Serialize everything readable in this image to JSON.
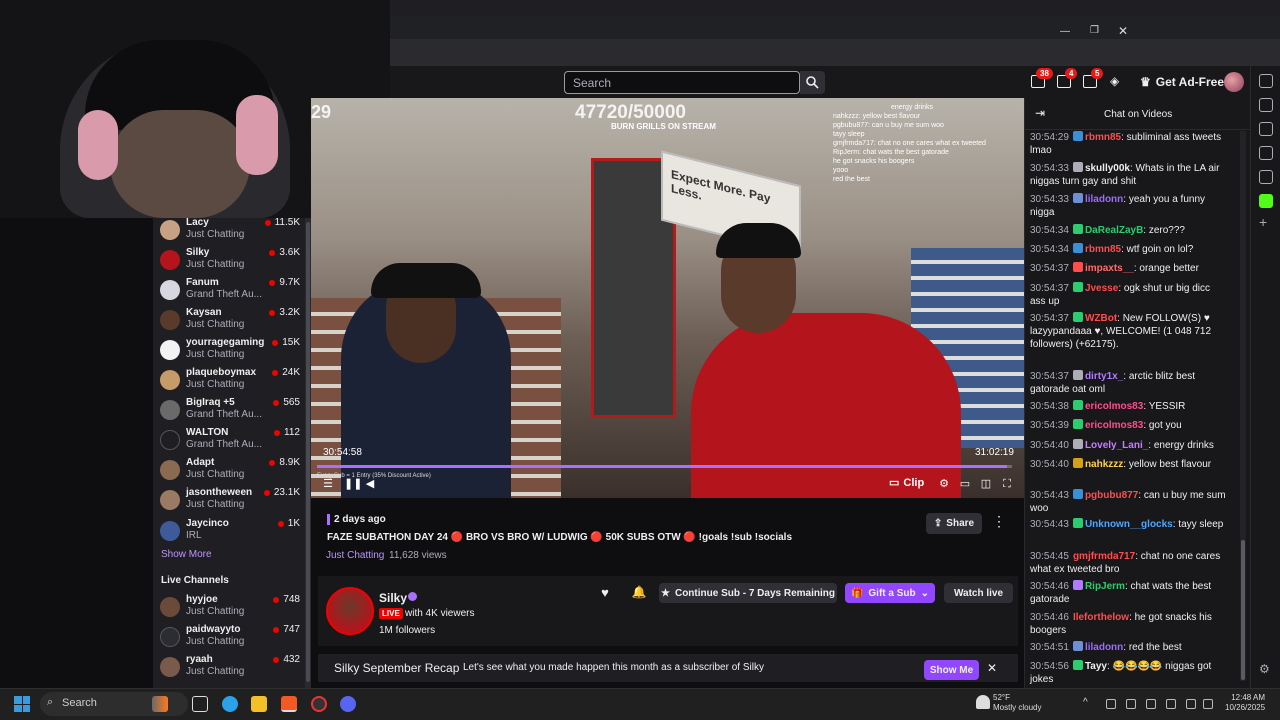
{
  "header": {
    "search_placeholder": "Search",
    "badges": [
      "38",
      "4",
      "5"
    ],
    "get_ad_free": "Get Ad-Free"
  },
  "sidebar": {
    "channels": [
      {
        "name": "Lacy",
        "game": "Just Chatting",
        "viewers": "11.5K",
        "color": "#c7a184"
      },
      {
        "name": "Silky",
        "game": "Just Chatting",
        "viewers": "3.6K",
        "color": "#b4141c"
      },
      {
        "name": "Fanum",
        "game": "Grand Theft Au...",
        "viewers": "9.7K",
        "color": "#d7d7e0"
      },
      {
        "name": "Kaysan",
        "game": "Just Chatting",
        "viewers": "3.2K",
        "color": "#5a3a2b"
      },
      {
        "name": "yourragegaming",
        "game": "Just Chatting",
        "viewers": "15K",
        "color": "#f2f2f2"
      },
      {
        "name": "plaqueboymax",
        "game": "Just Chatting",
        "viewers": "24K",
        "color": "#c79a6a"
      },
      {
        "name": "BigIraq +5",
        "game": "Grand Theft Au...",
        "viewers": "565",
        "color": "#6a6a6a"
      },
      {
        "name": "WALTON",
        "game": "Grand Theft Au...",
        "viewers": "112",
        "color": "#1f1f23"
      },
      {
        "name": "Adapt",
        "game": "Just Chatting",
        "viewers": "8.9K",
        "color": "#8a6a50"
      },
      {
        "name": "jasontheween",
        "game": "Just Chatting",
        "viewers": "23.1K",
        "color": "#9a7a62"
      },
      {
        "name": "Jaycinco",
        "game": "IRL",
        "viewers": "1K",
        "color": "#3f5a9a"
      }
    ],
    "show_more": "Show More",
    "live_channels_label": "Live Channels",
    "live_channels": [
      {
        "name": "hyyjoe",
        "game": "Just Chatting",
        "viewers": "748",
        "color": "#6b4a3a"
      },
      {
        "name": "paidwayyto",
        "game": "Just Chatting",
        "viewers": "747",
        "color": "#2c2c33"
      },
      {
        "name": "ryaah",
        "game": "Just Chatting",
        "viewers": "432",
        "color": "#7a5a4a"
      }
    ]
  },
  "video": {
    "left_number": "29",
    "goal_number": "47720/50000",
    "goal_caption": "BURN GRILLS ON STREAM",
    "overlay_chat": [
      "energy drinks",
      "nahkzzz: yellow best flavour",
      "pgbubu877: can u buy me sum woo",
      "tayy sleep",
      "gmjfrmda717: chat no one cares what ex tweeted",
      "RipJerm: chat wats the best gatorade",
      "he got snacks his boogers",
      "yooo",
      "red the best"
    ],
    "sign_text": "Expect More. Pay Less.",
    "time_current": "30:54:58",
    "time_total": "31:02:19",
    "progress": 0.993,
    "clip_label": "Clip",
    "goal_footer": "Every Sub = 1 Entry (35% Discount Active)"
  },
  "info": {
    "ago": "2 days ago",
    "title": "FAZE SUBATHON DAY 24 🔴 BRO VS BRO W/ LUDWIG 🔴 50K SUBS OTW 🔴 !goals !sub !socials",
    "category": "Just Chatting",
    "views": "11,628 views",
    "share": "Share",
    "channel_name": "Silky",
    "live": "LIVE",
    "viewers": "with 4K viewers",
    "followers": "1M followers",
    "continue_sub": "Continue Sub - 7 Days Remaining",
    "gift_sub": "Gift a Sub",
    "watch_live": "Watch live",
    "recap_title": "Silky September Recap",
    "recap_text": "Let's see what you made happen this month as a subscriber of Silky",
    "show_me": "Show Me"
  },
  "chat": {
    "title": "Chat on Videos",
    "messages": [
      {
        "ts": "30:54:29",
        "user": "rbmn85",
        "color": "#ff4d4d",
        "text": ": subliminal ass tweets lmao",
        "badge": "#3a8fd6"
      },
      {
        "ts": "30:54:33",
        "user": "skully00k",
        "color": "#efeff1",
        "text": ": Whats in the LA air niggas turn gay and shit",
        "badge": "#adadb8"
      },
      {
        "ts": "30:54:33",
        "user": "liladonn",
        "color": "#9c6bff",
        "text": ": yeah you a funny nigga",
        "badge": "#6c8fd6"
      },
      {
        "ts": "30:54:34",
        "user": "DaRealZayB",
        "color": "#2ecc71",
        "text": ": zero???",
        "badge": "#2ecc71"
      },
      {
        "ts": "30:54:34",
        "user": "rbmn85",
        "color": "#ff4d4d",
        "text": ": wtf goin on lol?",
        "badge": "#3a8fd6"
      },
      {
        "ts": "30:54:37",
        "user": "impaxts__",
        "color": "#ff6b6b",
        "text": ": orange better",
        "badge": "#ff4d4d"
      },
      {
        "ts": "30:54:37",
        "user": "Jvesse",
        "color": "#ff4d4d",
        "text": ": ogk shut ur big dicc ass up",
        "badge": "#2ecc71"
      },
      {
        "ts": "30:54:37",
        "user": "WZBot",
        "color": "#ff4d4d",
        "text": ": New FOLLOW(S) ♥ lazyypandaaa ♥, WELCOME! (1 048 712 followers) (+62175).",
        "badge": "#2ecc71"
      },
      {
        "ts": "30:54:37",
        "user": "dirty1x_",
        "color": "#b07cff",
        "text": ": arctic blitz best gatorade oat oml",
        "badge": "#adadb8"
      },
      {
        "ts": "30:54:38",
        "user": "ericolmos83",
        "color": "#ff4d8d",
        "text": ": YESSIR",
        "badge": "#2ecc71"
      },
      {
        "ts": "30:54:39",
        "user": "ericolmos83",
        "color": "#ff4d8d",
        "text": ": got you",
        "badge": "#2ecc71"
      },
      {
        "ts": "30:54:40",
        "user": "Lovely_Lani_",
        "color": "#c77dff",
        "text": ": energy drinks",
        "badge": "#adadb8"
      },
      {
        "ts": "30:54:40",
        "user": "nahkzzz",
        "color": "#ffd34d",
        "text": ": yellow best flavour",
        "badge": "#d4a017"
      },
      {
        "ts": "30:54:43",
        "user": "pgbubu877",
        "color": "#ff4d4d",
        "text": ": can u buy me sum woo",
        "badge": "#3a8fd6"
      },
      {
        "ts": "30:54:43",
        "user": "Unknown__glocks",
        "color": "#4da6ff",
        "text": ": tayy sleep",
        "badge": "#2ecc71"
      },
      {
        "ts": "30:54:45",
        "user": "gmjfrmda717",
        "color": "#ff4d4d",
        "text": ": chat no one cares what ex tweeted bro",
        "badge": ""
      },
      {
        "ts": "30:54:46",
        "user": "RipJerm",
        "color": "#2ecc71",
        "text": ": chat wats the best gatorade",
        "badge": "#b07cff"
      },
      {
        "ts": "30:54:46",
        "user": "Ileforthelow",
        "color": "#ff4d4d",
        "text": ": he got snacks his boogers",
        "badge": ""
      },
      {
        "ts": "30:54:51",
        "user": "liladonn",
        "color": "#9c6bff",
        "text": ": red the best",
        "badge": "#6c8fd6"
      },
      {
        "ts": "30:54:56",
        "user": "Tayy",
        "color": "#efeff1",
        "text": ": 😂😂😂😂 niggas got jokes",
        "badge": "#2ecc71"
      }
    ]
  },
  "taskbar": {
    "search": "Search",
    "temp": "52°F",
    "weather": "Mostly cloudy",
    "time": "12:48 AM",
    "date": "10/26/2025"
  }
}
